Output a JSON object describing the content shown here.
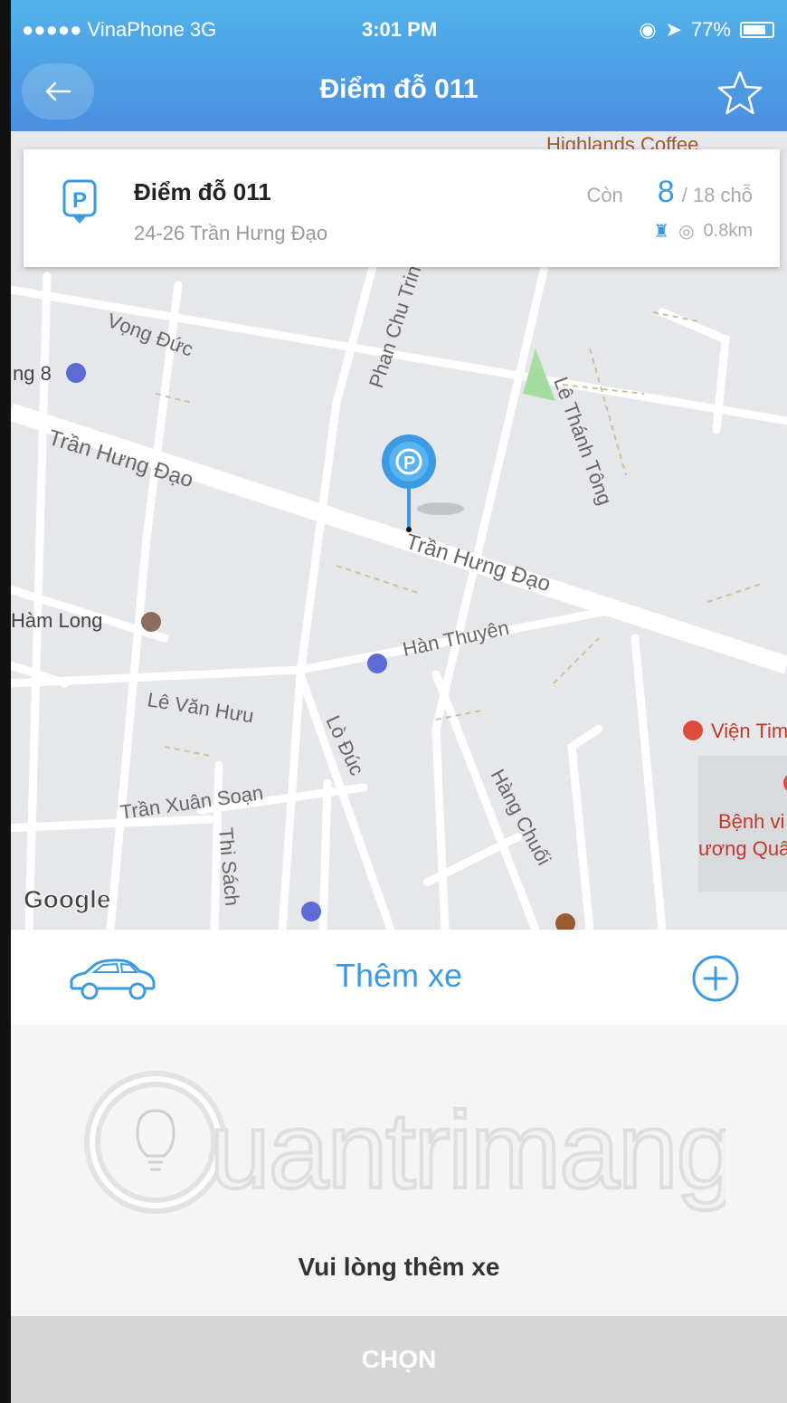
{
  "status_bar": {
    "carrier": "●●●●● VinaPhone  3G",
    "time": "3:01 PM",
    "battery": "77%"
  },
  "nav": {
    "title": "Điểm đỗ 011"
  },
  "card": {
    "name": "Điểm đỗ 011",
    "address": "24-26 Trần Hưng Đạo",
    "remaining_label": "Còn",
    "available": "8",
    "capacity": "/ 18 chỗ",
    "distance": "0.8km"
  },
  "map": {
    "streets": [
      "Vọng Đức",
      "Trần Hưng Đạo",
      "Trần Hưng Đạo",
      "Phan Chu Trinh",
      "Lê Thánh Tông",
      "Hàn Thuyên",
      "Lê Văn Hưu",
      "Lò Đúc",
      "Trần Xuân Soạn",
      "Thi Sách",
      "Hàng Chuối",
      "Hàm Long"
    ],
    "pois": [
      "Highlands Coffee",
      "Viện Tim",
      "Bệnh vi",
      "ương Quâ",
      "ng 8"
    ],
    "attribution": "Google"
  },
  "vehicle": {
    "add_label": "Thêm xe"
  },
  "empty": {
    "watermark": "Quantrimang",
    "message": "Vui lòng thêm xe"
  },
  "footer": {
    "select_label": "CHỌN"
  },
  "colors": {
    "header_top": "#52b2ea",
    "header_bottom": "#4a8fdf",
    "accent": "#3b9ae1"
  }
}
